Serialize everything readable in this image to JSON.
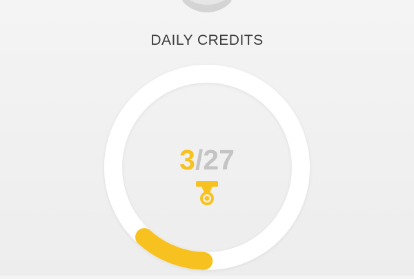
{
  "header": {
    "title": "DAILY CREDITS"
  },
  "avatar": {
    "icon": "avatar-icon"
  },
  "credits": {
    "current": "3",
    "separator": "/",
    "total": "27",
    "progress_fraction": 0.111
  },
  "medal": {
    "icon": "medal-icon"
  },
  "colors": {
    "accent": "#f7c21f",
    "ring": "#ffffff",
    "muted_text": "#c4c4c4",
    "title_text": "#3b3b3b"
  }
}
